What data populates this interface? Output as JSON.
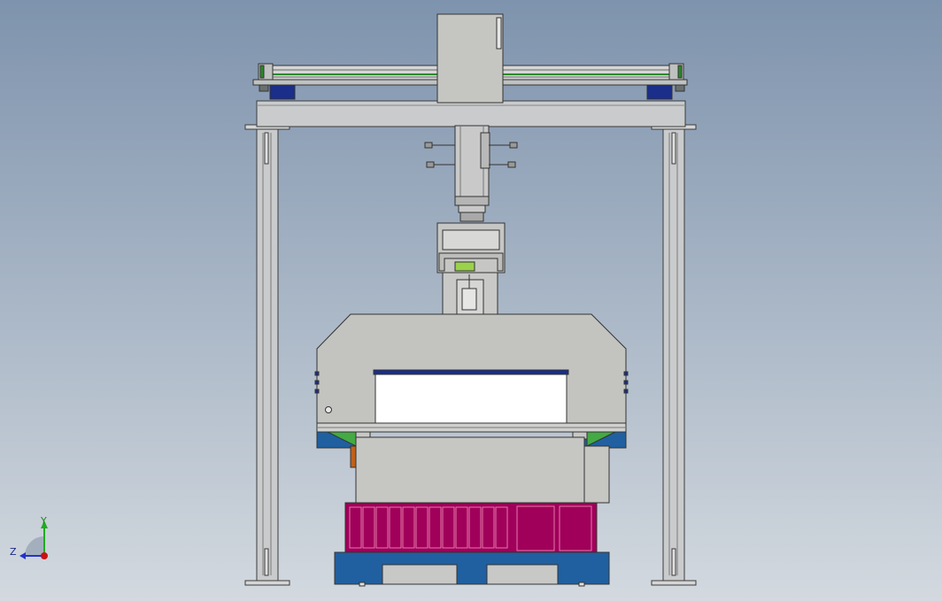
{
  "axis_triad": {
    "y_label": "Y",
    "z_label": "Z"
  },
  "colors": {
    "bg_top": "#7e93ad",
    "bg_bottom": "#d2d8df",
    "frame": "#c9cbcc",
    "frame_dark": "#9fa3a5",
    "machine_gray": "#c3c4c0",
    "magenta": "#a0005a",
    "blue": "#2060a0",
    "navy": "#1a2e8a",
    "green": "#44aa44",
    "lime": "#9ad24a",
    "purple": "#5a2a9a",
    "orange": "#c06018",
    "axis_red": "#cc1111",
    "axis_green": "#22aa22",
    "axis_blue": "#2233cc"
  }
}
